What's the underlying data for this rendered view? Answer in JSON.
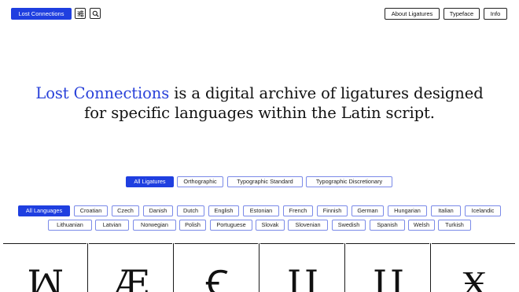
{
  "header": {
    "brand_label": "Lost Connections",
    "filter_icon": "sliders-icon",
    "search_icon": "search-icon",
    "nav": [
      "About Ligatures",
      "Typeface",
      "Info"
    ]
  },
  "intro": {
    "accent": "Lost Connections",
    "line1_rest": " is a digital archive of ligatures designed",
    "line2": "for specific languages within the Latin script."
  },
  "categories": [
    "All Ligatures",
    "Orthographic",
    "Typographic Standard",
    "Typographic Discretionary"
  ],
  "languages_row1": [
    "All Languages",
    "Croatian",
    "Czech",
    "Danish",
    "Dutch",
    "English",
    "Estonian",
    "French",
    "Finnish",
    "German",
    "Hungarian",
    "Italian",
    "Icelandic"
  ],
  "languages_row2": [
    "Lithuanian",
    "Latvian",
    "Norwegian",
    "Polish",
    "Portuguese",
    "Slovak",
    "Slovenian",
    "Swedish",
    "Spanish",
    "Welsh",
    "Turkish"
  ],
  "glyphs": [
    "ꟽ",
    "Æ",
    "Ꞓ",
    "Ц",
    "Ц",
    "Ӿ"
  ],
  "colors": {
    "accent": "#1f3fe0",
    "accent_text": "#2941d9",
    "chip_border": "#7a8ae8"
  }
}
